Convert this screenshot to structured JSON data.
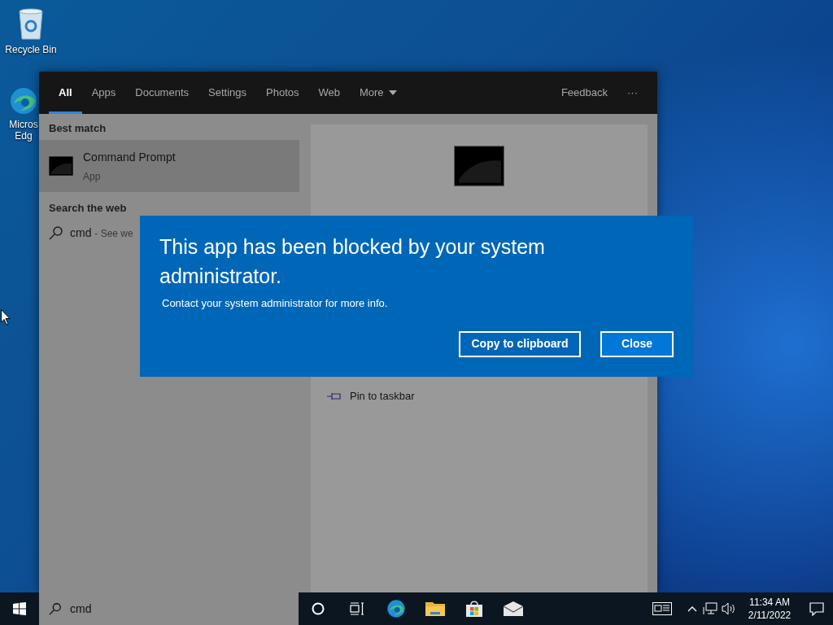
{
  "desktop_icons": [
    {
      "kind": "recycle",
      "lines": [
        "Recycle Bin"
      ]
    },
    {
      "kind": "browser",
      "lines": [
        "Micros",
        "Edg"
      ]
    }
  ],
  "search_panel": {
    "tabs": [
      {
        "label": "All",
        "selected": true
      },
      {
        "label": "Apps",
        "selected": false
      },
      {
        "label": "Documents",
        "selected": false
      },
      {
        "label": "Settings",
        "selected": false
      },
      {
        "label": "Photos",
        "selected": false
      },
      {
        "label": "Web",
        "selected": false
      }
    ],
    "more": "More",
    "feedback": "Feedback",
    "ellipsis": "···",
    "best_match_heading": "Best match",
    "best_match": {
      "title": "Command Prompt",
      "subtitle": "App",
      "selected": true
    },
    "web_heading": "Search the web",
    "web_result": {
      "query": "cmd",
      "hint": "- See we"
    },
    "preview": {
      "action": "Pin to taskbar"
    }
  },
  "dialog": {
    "title": "This app has been blocked by your system administrator.",
    "message": "Contact your system administrator for more info.",
    "buttons": [
      {
        "label": "Copy to clipboard",
        "kind": "secondary"
      },
      {
        "label": "Close",
        "kind": "primary"
      }
    ]
  },
  "taskbar": {
    "search_value": "cmd",
    "time": "11:34 AM",
    "date": "2/11/2022"
  }
}
